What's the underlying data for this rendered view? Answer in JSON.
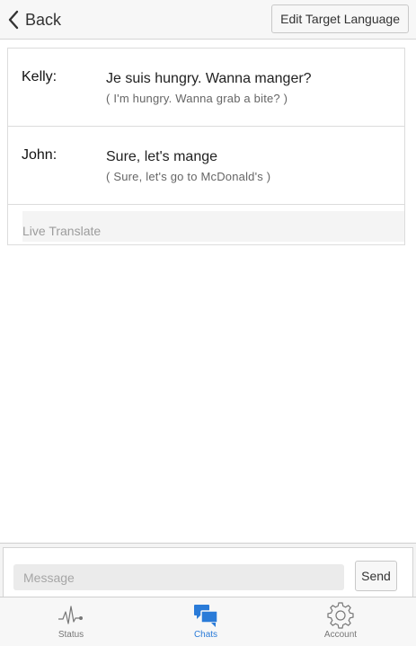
{
  "header": {
    "back_label": "Back",
    "edit_label": "Edit Target Language"
  },
  "chat": {
    "messages": [
      {
        "speaker": "Kelly:",
        "text": "Je suis hungry. Wanna manger?",
        "translation": "( I'm hungry. Wanna grab a bite? )"
      },
      {
        "speaker": "John:",
        "text": "Sure, let's mange",
        "translation": "( Sure, let's go to McDonald's )"
      }
    ],
    "live_translate_placeholder": "Live Translate"
  },
  "composer": {
    "message_placeholder": "Message",
    "send_label": "Send"
  },
  "tabs": [
    {
      "label": "Status",
      "icon": "pulse-icon",
      "active": false
    },
    {
      "label": "Chats",
      "icon": "chat-bubbles-icon",
      "active": true
    },
    {
      "label": "Account",
      "icon": "gear-icon",
      "active": false
    }
  ],
  "colors": {
    "accent": "#2a7bd8",
    "inactive_tab": "#777777"
  }
}
